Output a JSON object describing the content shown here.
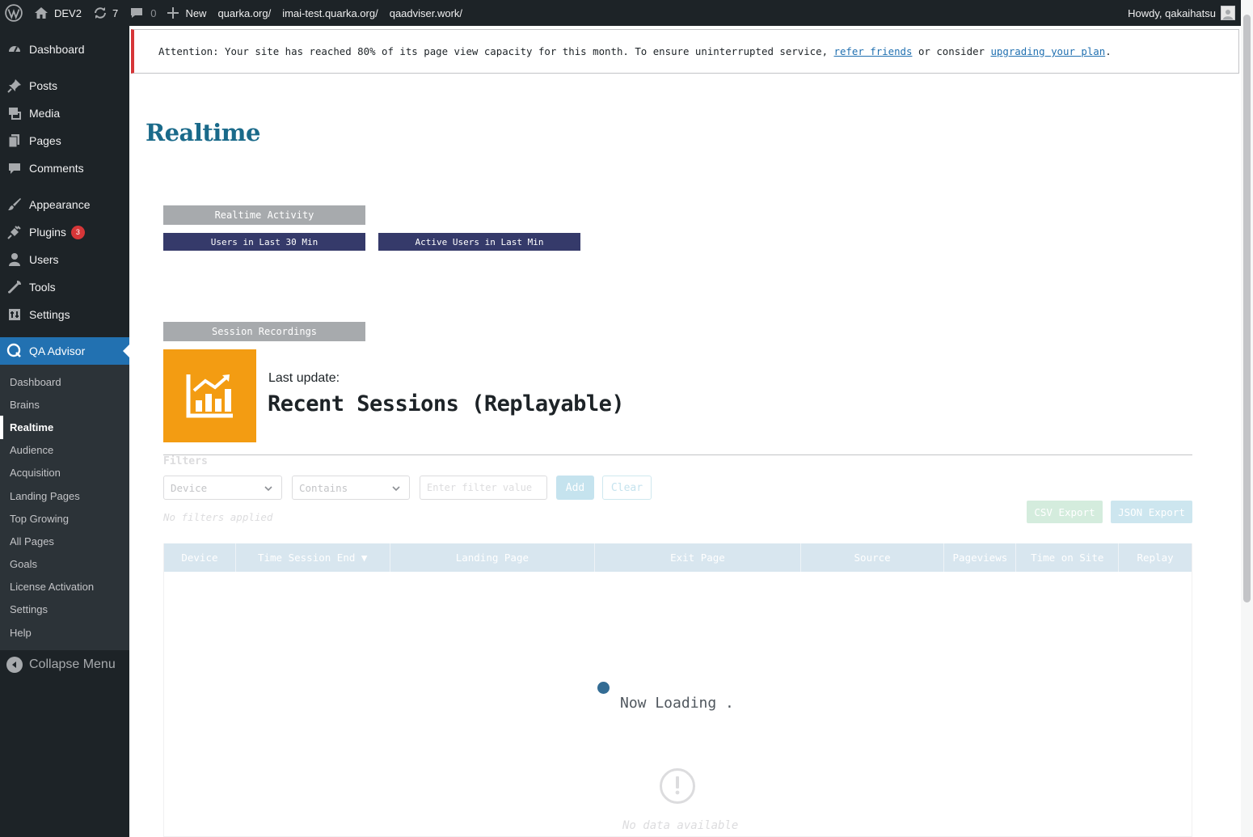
{
  "adminbar": {
    "site_name": "DEV2",
    "updates_count": "7",
    "comments_count": "0",
    "new_label": "New",
    "links": [
      "quarka.org/",
      "imai-test.quarka.org/",
      "qaadviser.work/"
    ],
    "howdy": "Howdy, qakaihatsu"
  },
  "sidebar": {
    "items": [
      {
        "label": "Dashboard",
        "icon": "dashboard-icon"
      },
      {
        "label": "Posts",
        "icon": "pin-icon"
      },
      {
        "label": "Media",
        "icon": "media-icon"
      },
      {
        "label": "Pages",
        "icon": "pages-icon"
      },
      {
        "label": "Comments",
        "icon": "comment-icon"
      },
      {
        "label": "Appearance",
        "icon": "brush-icon"
      },
      {
        "label": "Plugins",
        "icon": "plug-icon",
        "badge": "3"
      },
      {
        "label": "Users",
        "icon": "user-icon"
      },
      {
        "label": "Tools",
        "icon": "wrench-icon"
      },
      {
        "label": "Settings",
        "icon": "settings-icon"
      },
      {
        "label": "QA Advisor",
        "icon": "qa-icon"
      }
    ],
    "submenu": [
      "Dashboard",
      "Brains",
      "Realtime",
      "Audience",
      "Acquisition",
      "Landing Pages",
      "Top Growing",
      "All Pages",
      "Goals",
      "License Activation",
      "Settings",
      "Help"
    ],
    "active_submenu": "Realtime",
    "collapse_label": "Collapse Menu"
  },
  "notice": {
    "text_before": "Attention: Your site has reached 80% of its page view capacity for this month. To ensure uninterrupted service, ",
    "link1": "refer friends",
    "text_middle": " or consider ",
    "link2": "upgrading your plan",
    "text_after": "."
  },
  "page": {
    "title": "Realtime",
    "realtime_activity": "Realtime Activity",
    "users_30": "Users in Last 30 Min",
    "active_users": "Active Users in Last Min",
    "session_recordings": "Session Recordings",
    "last_update": "Last update:",
    "recent_title": "Recent Sessions (Replayable)"
  },
  "filters": {
    "label": "Filters",
    "device_select": "Device",
    "operator_select": "Contains",
    "value_placeholder": "Enter filter value",
    "add_label": "Add",
    "clear_label": "Clear",
    "status": "No filters applied",
    "csv_export": "CSV Export",
    "json_export": "JSON Export"
  },
  "table": {
    "columns": [
      "Device",
      "Time Session End ▼",
      "Landing Page",
      "Exit Page",
      "Source",
      "Pageviews",
      "Time on Site",
      "Replay"
    ],
    "loading": "Now Loading .",
    "empty": "No data available"
  },
  "colors": {
    "accent": "#2271b1",
    "title": "#1a6a8a",
    "stat_box": "#f39c12",
    "navy_pill": "#353a6a",
    "alert": "#d63638"
  }
}
